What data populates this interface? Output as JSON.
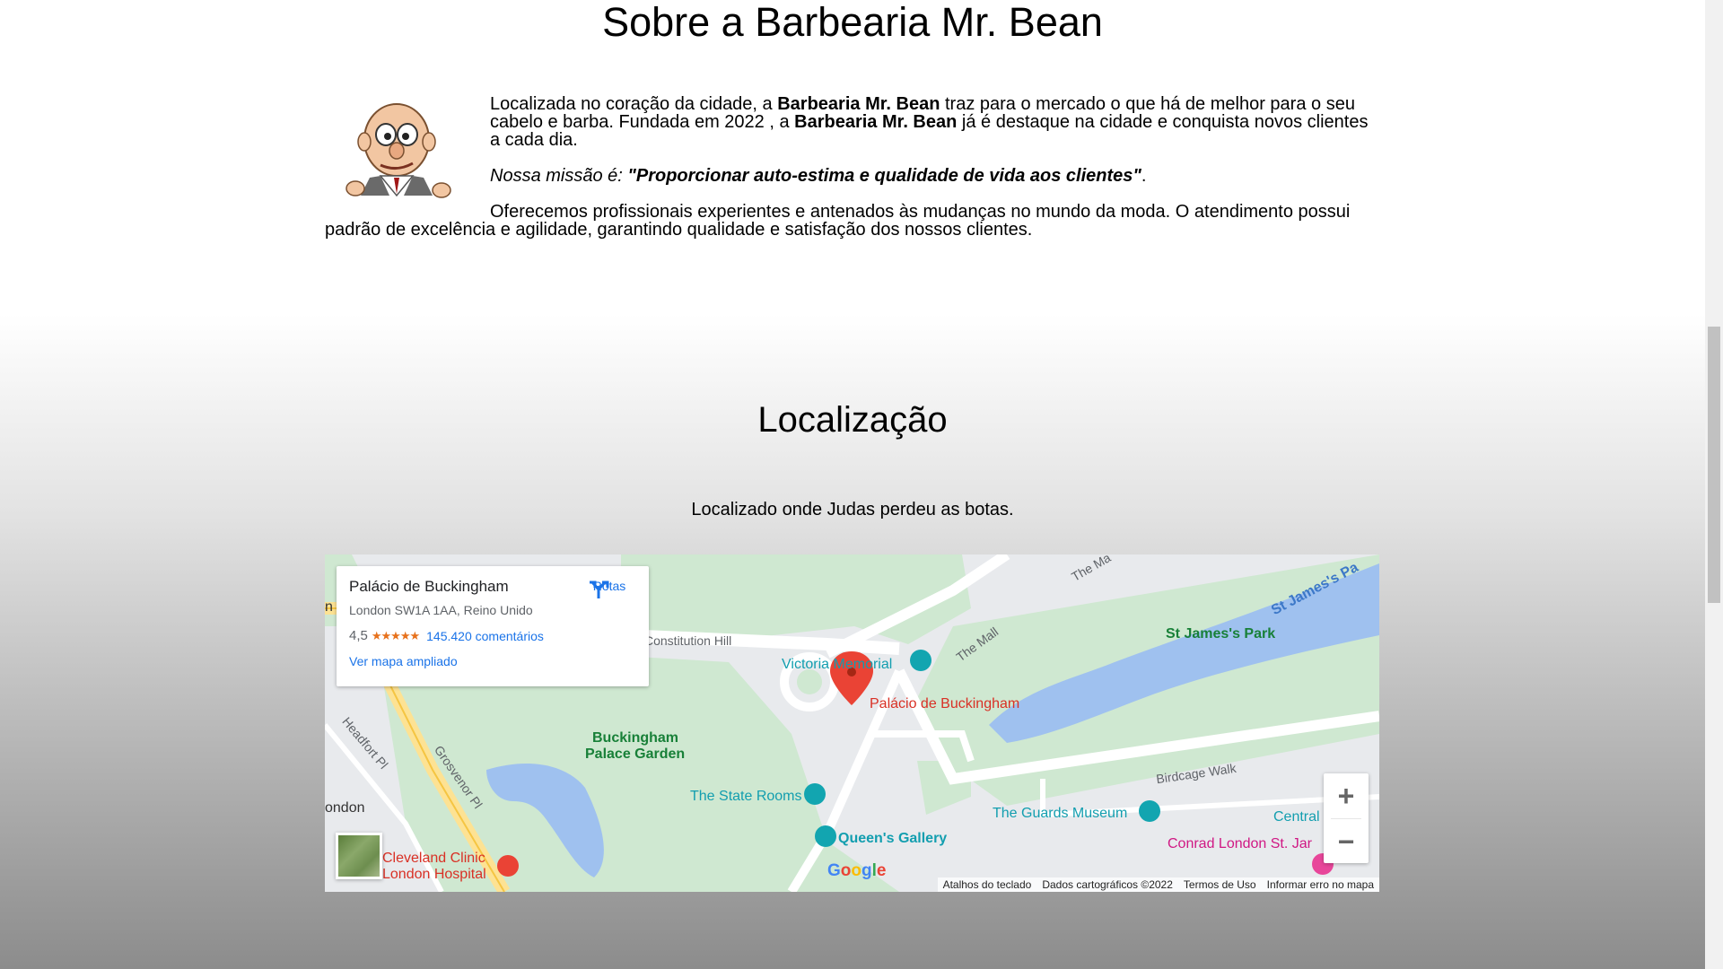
{
  "about": {
    "title": "Sobre a Barbearia Mr. Bean",
    "p1_a": "Localizada no coração da cidade, a ",
    "p1_brand1": "Barbearia Mr. Bean",
    "p1_b": " traz para o mercado o que há de melhor para o seu cabelo e barba. Fundada em 2022 , a ",
    "p1_brand2": "Barbearia Mr. Bean",
    "p1_c": " já é destaque na cidade e conquista novos clientes a cada dia.",
    "mission_label": "Nossa missão é: ",
    "mission_text": "\"Proporcionar auto-estima e qualidade de vida aos clientes\"",
    "mission_end": ".",
    "p3": "Oferecemos profissionais experientes e antenados às mudanças no mundo da moda. O atendimento possui padrão de excelência e agilidade, garantindo qualidade e satisfação dos nossos clientes."
  },
  "location": {
    "title": "Localização",
    "subtitle": "Localizado onde Judas perdeu as botas."
  },
  "map": {
    "place_name": "Palácio de Buckingham",
    "address": "London SW1A 1AA, Reino Unido",
    "rating": "4,5",
    "reviews": "145.420 comentários",
    "bigger_map": "Ver mapa ampliado",
    "directions": "Rotas",
    "zoom_in": "+",
    "zoom_out": "−",
    "google": "Google",
    "attrib_keyboard": "Atalhos do teclado",
    "attrib_data": "Dados cartográficos ©2022",
    "attrib_terms": "Termos de Uso",
    "attrib_report": "Informar erro no mapa",
    "labels": {
      "constitution_hill": "Constitution Hill",
      "victoria_memorial": "Victoria Memorial",
      "the_mall": "The Mall",
      "the_ma": "The Ma",
      "st_james_park": "St James's Park",
      "st_james_pa": "St James's Pa",
      "palace_pin": "Palácio de Buckingham",
      "bpg_1": "Buckingham",
      "bpg_2": "Palace Garden",
      "birdcage": "Birdcage Walk",
      "state_rooms": "The State Rooms",
      "guards_museum": "The Guards Museum",
      "queens_gallery": "Queen's Gallery",
      "conrad": "Conrad London St. Jar",
      "central": "Central",
      "cleveland_1": "Cleveland Clinic",
      "cleveland_2": "London Hospital",
      "grosvenor": "Grosvenor Pl",
      "headfort": "Headfort Pl",
      "london": "ondon",
      "n": "n"
    }
  },
  "colors": {
    "park_green": "#cfe8d1",
    "water_blue": "#9fc1ef",
    "major_road": "#fde293",
    "pin_red": "#ea4335"
  }
}
